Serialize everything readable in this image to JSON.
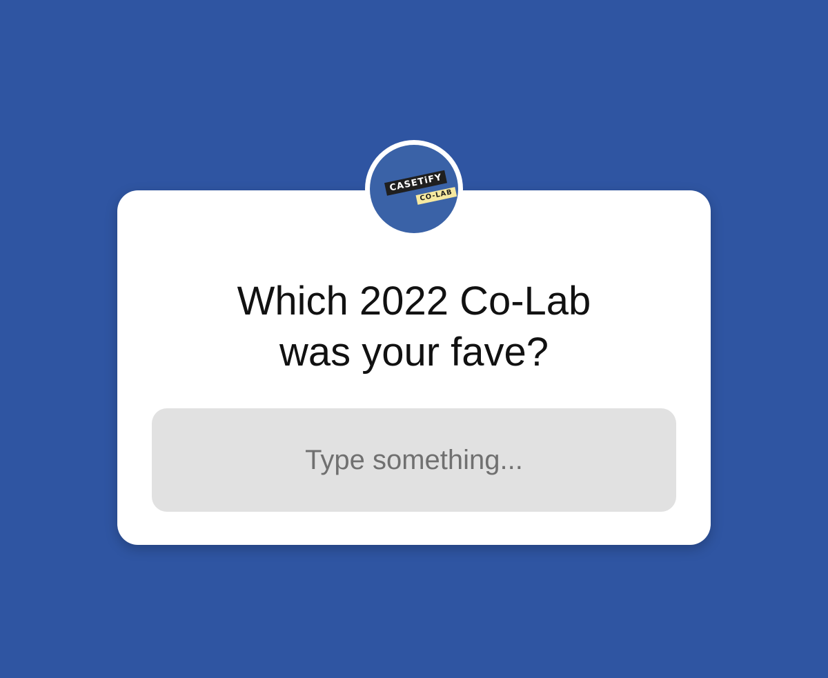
{
  "colors": {
    "background": "#2f55a2",
    "card": "#ffffff",
    "avatar": "#3a62a7",
    "input_background": "#e1e1e1",
    "placeholder": "#707070"
  },
  "avatar": {
    "icon": "casetify-co-lab-logo",
    "logo_text_top": "CASETiFY",
    "logo_text_bottom": "CO-LAB"
  },
  "question_sticker": {
    "question_line_1": "Which 2022 Co-Lab",
    "question_line_2": "was your fave?",
    "answer_placeholder": "Type something...",
    "answer_value": ""
  }
}
